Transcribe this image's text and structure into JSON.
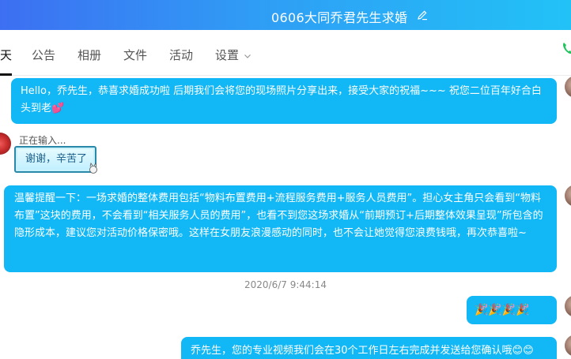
{
  "header": {
    "title": "0606大同乔君先生求婚"
  },
  "tabs": [
    {
      "label": "天",
      "active": true
    },
    {
      "label": "公告"
    },
    {
      "label": "相册"
    },
    {
      "label": "文件"
    },
    {
      "label": "活动"
    },
    {
      "label": "设置"
    }
  ],
  "messages": {
    "m1": "Hello，乔先生，恭喜求婚成功啦 后期我们会将您的现场照片分享出来，接受大家的祝福~~~ 祝您二位百年好合白头到老💕",
    "typing": "正在输入...",
    "sticker": "谢谢，辛苦了",
    "m3": "温馨提醒一下：一场求婚的整体费用包括“物料布置费用+流程服务费用+服务人员费用”。担心女主角只会看到“物料布置”这块的费用，不会看到“相关服务人员的费用”，也看不到您这场求婚从“前期预订+后期整体效果呈现”所包含的隐形成本，建议您对活动价格保密哦。这样在女朋友浪漫感动的同时，也不会让她觉得您浪费钱哦，再次恭喜啦~",
    "timestamp": "2020/6/7 9:44:14",
    "m4": "🎉🎉🎉🎉",
    "m5": "乔先生，您的专业视频我们会在30个工作日左右完成并发送给您确认哦😊😊"
  },
  "colors": {
    "bubble": "#12b7f5",
    "header_start": "#3d6ff2",
    "header_end": "#22c2f7"
  }
}
